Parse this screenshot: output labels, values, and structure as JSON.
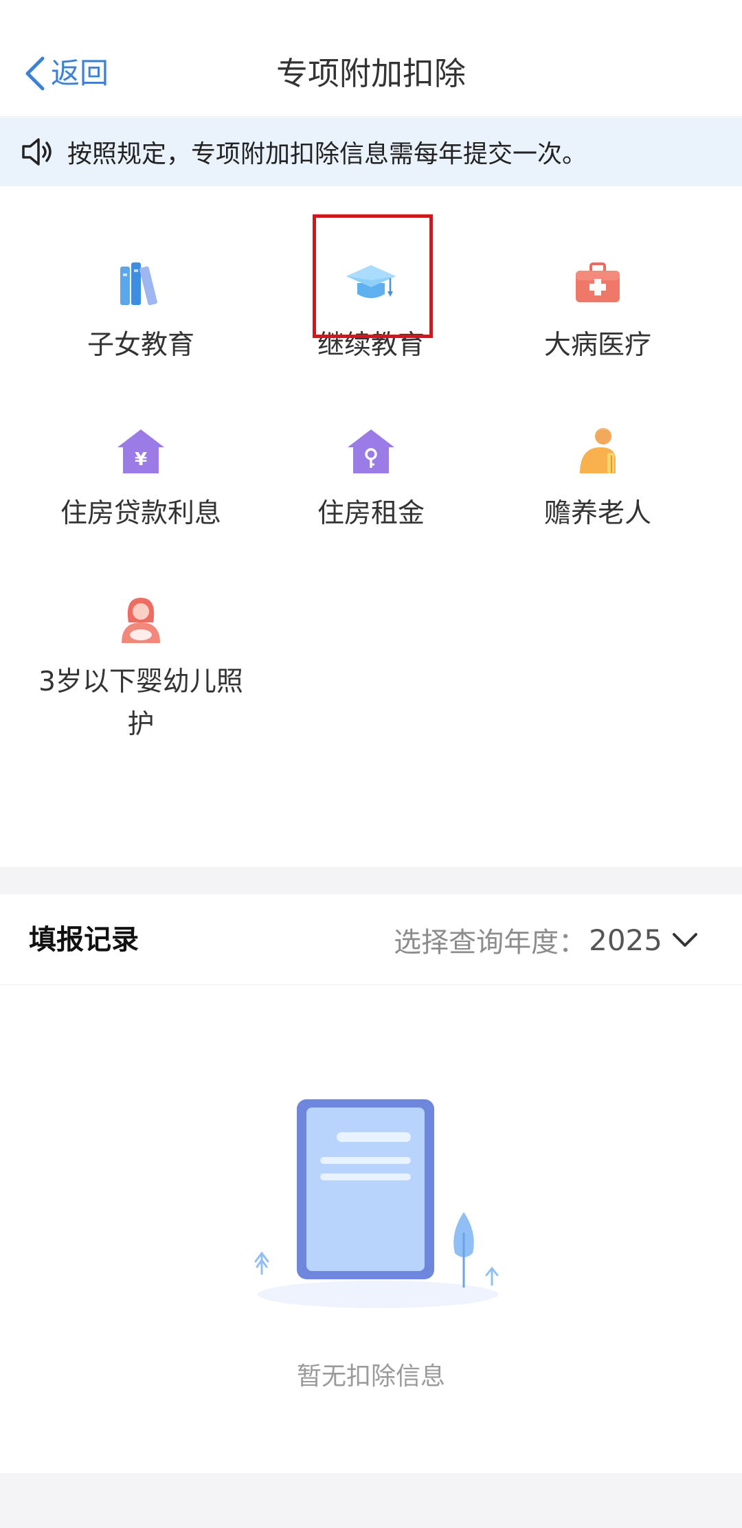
{
  "header": {
    "back_label": "返回",
    "title": "专项附加扣除"
  },
  "notice": {
    "text": "按照规定，专项附加扣除信息需每年提交一次。",
    "icon": "speaker-icon"
  },
  "items": [
    {
      "label": "子女教育",
      "icon": "books-icon"
    },
    {
      "label": "继续教育",
      "icon": "graduation-cap-icon",
      "highlighted": true
    },
    {
      "label": "大病医疗",
      "icon": "medical-kit-icon"
    },
    {
      "label": "住房贷款利息",
      "icon": "house-yuan-icon"
    },
    {
      "label": "住房租金",
      "icon": "house-key-icon"
    },
    {
      "label": "赡养老人",
      "icon": "elderly-icon"
    },
    {
      "label": "3岁以下婴幼儿照护",
      "icon": "infant-care-icon"
    }
  ],
  "records": {
    "title": "填报记录",
    "year_label": "选择查询年度：",
    "year_value": "2025",
    "empty_text": "暂无扣除信息"
  },
  "colors": {
    "accent": "#3b82d6",
    "highlight_border": "#e0101a",
    "notice_bg": "#eaf3fb"
  }
}
